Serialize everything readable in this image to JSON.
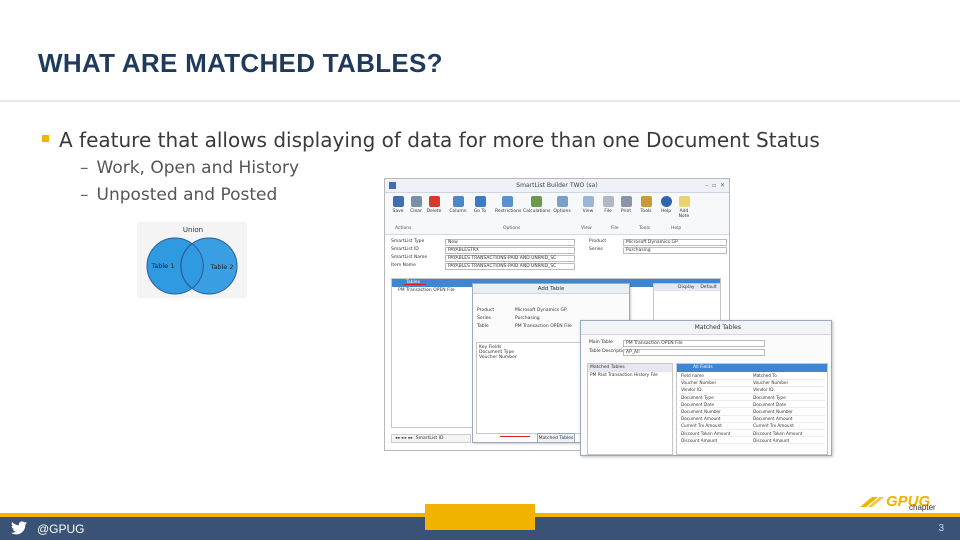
{
  "slide": {
    "title": "WHAT ARE MATCHED TABLES?",
    "bullet": "A feature that allows displaying of data for more than one Document Status",
    "sub_bullets": [
      "Work, Open and History",
      "Unposted and Posted"
    ]
  },
  "venn": {
    "title": "Union",
    "left": "Table 1",
    "right": "Table 2",
    "fill_color": "#2f9ae0"
  },
  "smartlist_window": {
    "title": "SmartList Builder   TWO (sa)",
    "ribbon": [
      {
        "label": "Save",
        "icon": "save-icon"
      },
      {
        "label": "Clear",
        "icon": "clear-icon"
      },
      {
        "label": "Delete",
        "icon": "delete-icon"
      },
      {
        "label": "Column",
        "icon": "column-icon"
      },
      {
        "label": "Go To",
        "icon": "goto-icon"
      },
      {
        "label": "Restrictions",
        "icon": "restrictions-icon"
      },
      {
        "label": "Calculations",
        "icon": "calculations-icon"
      },
      {
        "label": "Options",
        "icon": "options-icon"
      },
      {
        "label": "View",
        "icon": "view-icon"
      },
      {
        "label": "File",
        "icon": "file-icon"
      },
      {
        "label": "Print",
        "icon": "print-icon"
      },
      {
        "label": "Tools",
        "icon": "tools-icon"
      },
      {
        "label": "Help",
        "icon": "help-icon"
      },
      {
        "label": "Add Note",
        "icon": "note-icon"
      }
    ],
    "groups": [
      "Actions",
      "Options",
      "View",
      "File",
      "Tools",
      "Help"
    ],
    "fields": [
      {
        "label": "SmartList Type",
        "value": "New",
        "label2": "Product",
        "value2": "Microsoft Dynamics GP"
      },
      {
        "label": "SmartList ID",
        "value": "PAYABLESTRX",
        "label2": "Series",
        "value2": "Purchasing"
      },
      {
        "label": "SmartList Name",
        "value": "PAYABLES TRANSACTIONS-PAID AND UNPAID_SC",
        "label2": "",
        "value2": ""
      },
      {
        "label": "Item Name",
        "value": "PAYABLES TRANSACTIONS-PAID AND UNPAID_SC",
        "label2": "",
        "value2": ""
      }
    ],
    "tables_header": "Tables",
    "tables_items": [
      "PM Transaction OPEN File"
    ],
    "right_columns": [
      "Display",
      "Default"
    ],
    "bottom_field": "SmartList ID",
    "matched_button": "Matched Tables"
  },
  "add_table": {
    "title": "Add Table",
    "rows": [
      {
        "k": "Product",
        "v": "Microsoft Dynamics GP"
      },
      {
        "k": "Series",
        "v": "Purchasing"
      },
      {
        "k": "Table",
        "v": "PM Transaction OPEN File"
      }
    ],
    "key_fields_label": "Key Fields",
    "key_fields": [
      "Document Type",
      "Voucher Number"
    ]
  },
  "matched_tables": {
    "title": "Matched Tables",
    "rows": [
      {
        "k": "Main Table",
        "v": "PM Transaction OPEN File"
      },
      {
        "k": "Table Description",
        "v": "AP_All"
      }
    ],
    "left_header": "Matched Tables",
    "left_items": [
      "PM Paid Transaction History File"
    ],
    "right_header": "All Fields",
    "columns": [
      "Field name",
      "Matched To"
    ],
    "field_rows": [
      [
        "Voucher Number",
        "Voucher Number"
      ],
      [
        "Vendor ID",
        "Vendor ID"
      ],
      [
        "Document Type",
        "Document Type"
      ],
      [
        "Document Date",
        "Document Date"
      ],
      [
        "Document Number",
        "Document Number"
      ],
      [
        "Document Amount",
        "Document Amount"
      ],
      [
        "Current Trx Amount",
        "Current Trx Amount"
      ],
      [
        "Discount Taken Amount",
        "Discount Taken Amount"
      ],
      [
        "Discount Amount",
        "Discount Amount"
      ]
    ]
  },
  "footer": {
    "handle": "@GPUG",
    "page": "3",
    "logo_text": "GPUG",
    "logo_sub": "chapter"
  },
  "colors": {
    "title": "#1f3a5c",
    "accent": "#f0b400",
    "footer": "#3a5275"
  }
}
